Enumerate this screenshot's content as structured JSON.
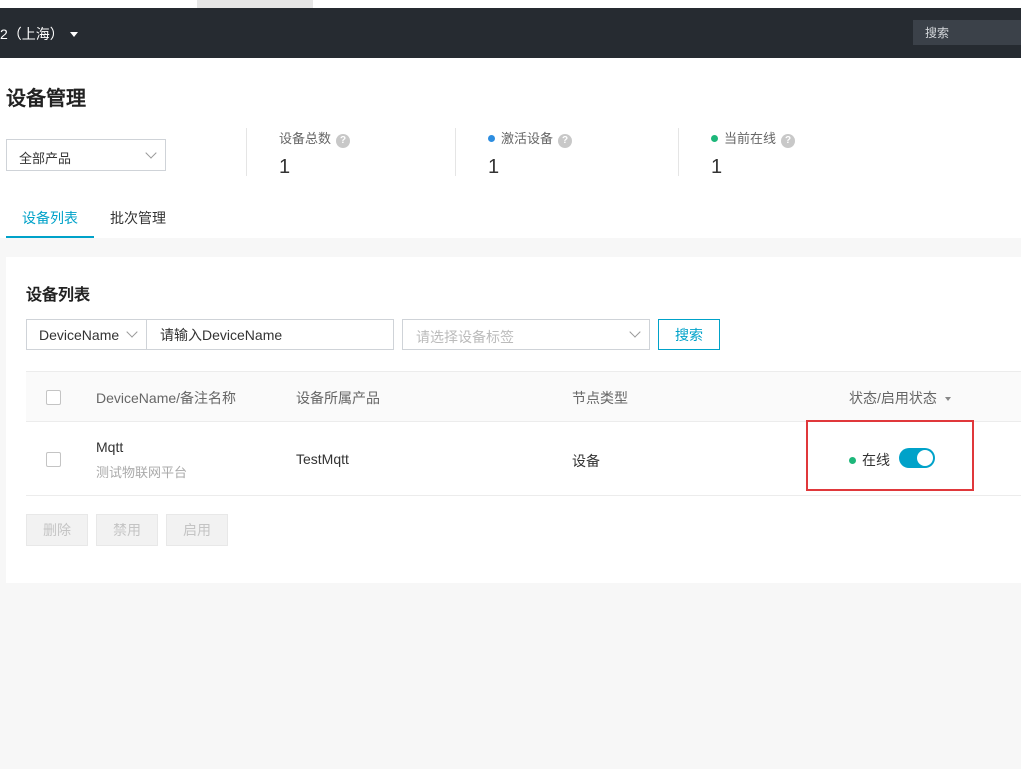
{
  "topbar": {
    "region": "2（上海）",
    "search_placeholder": "搜索"
  },
  "page": {
    "title": "设备管理"
  },
  "product_filter": {
    "selected": "全部产品"
  },
  "stats": [
    {
      "label": "设备总数",
      "value": "1",
      "dot_color": ""
    },
    {
      "label": "激活设备",
      "value": "1",
      "dot_color": "#2d8de0"
    },
    {
      "label": "当前在线",
      "value": "1",
      "dot_color": "#1db77a"
    }
  ],
  "tabs": [
    {
      "label": "设备列表",
      "active": true
    },
    {
      "label": "批次管理",
      "active": false
    }
  ],
  "section": {
    "title": "设备列表"
  },
  "filters": {
    "field_selected": "DeviceName",
    "name_placeholder": "请输入DeviceName",
    "tag_placeholder": "请选择设备标签",
    "search_label": "搜索"
  },
  "table": {
    "headers": {
      "name": "DeviceName/备注名称",
      "product": "设备所属产品",
      "node_type": "节点类型",
      "status": "状态/启用状态"
    },
    "rows": [
      {
        "name": "Mqtt",
        "remark": "测试物联网平台",
        "product": "TestMqtt",
        "node_type": "设备",
        "status": "在线",
        "enabled": true
      }
    ]
  },
  "actions": {
    "delete": "删除",
    "disable": "禁用",
    "enable": "启用"
  },
  "colors": {
    "accent": "#00a2c9",
    "online": "#1db77a",
    "activated": "#2d8de0",
    "highlight": "#e0383b",
    "topbar": "#262b31"
  }
}
